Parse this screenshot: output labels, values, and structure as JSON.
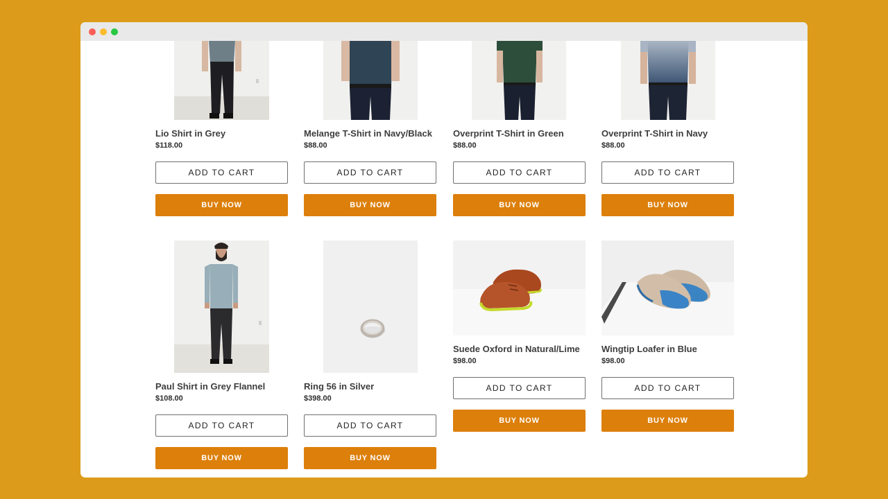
{
  "colors": {
    "background": "#DC9B1A",
    "buy_button": "#DC7F0B",
    "traffic_red": "#FC5F57",
    "traffic_yellow": "#FDBC2E",
    "traffic_green": "#28C840"
  },
  "products": [
    {
      "title": "Lio Shirt in Grey",
      "price": "$118.00",
      "add_label": "ADD TO CART",
      "buy_label": "BUY NOW",
      "image": "man-grey-shirt"
    },
    {
      "title": "Melange T-Shirt in Navy/Black",
      "price": "$88.00",
      "add_label": "ADD TO CART",
      "buy_label": "BUY NOW",
      "image": "man-navy-tshirt"
    },
    {
      "title": "Overprint T-Shirt in Green",
      "price": "$88.00",
      "add_label": "ADD TO CART",
      "buy_label": "BUY NOW",
      "image": "man-green-tshirt"
    },
    {
      "title": "Overprint T-Shirt in Navy",
      "price": "$88.00",
      "add_label": "ADD TO CART",
      "buy_label": "BUY NOW",
      "image": "man-navy-gradient-tshirt"
    },
    {
      "title": "Paul Shirt in Grey Flannel",
      "price": "$108.00",
      "add_label": "ADD TO CART",
      "buy_label": "BUY NOW",
      "image": "man-flannel-shirt"
    },
    {
      "title": "Ring 56 in Silver",
      "price": "$398.00",
      "add_label": "ADD TO CART",
      "buy_label": "BUY NOW",
      "image": "silver-ring"
    },
    {
      "title": "Suede Oxford in Natural/Lime",
      "price": "$98.00",
      "add_label": "ADD TO CART",
      "buy_label": "BUY NOW",
      "image": "suede-oxford-shoes"
    },
    {
      "title": "Wingtip Loafer in Blue",
      "price": "$98.00",
      "add_label": "ADD TO CART",
      "buy_label": "BUY NOW",
      "image": "wingtip-loafer-shoes"
    }
  ]
}
